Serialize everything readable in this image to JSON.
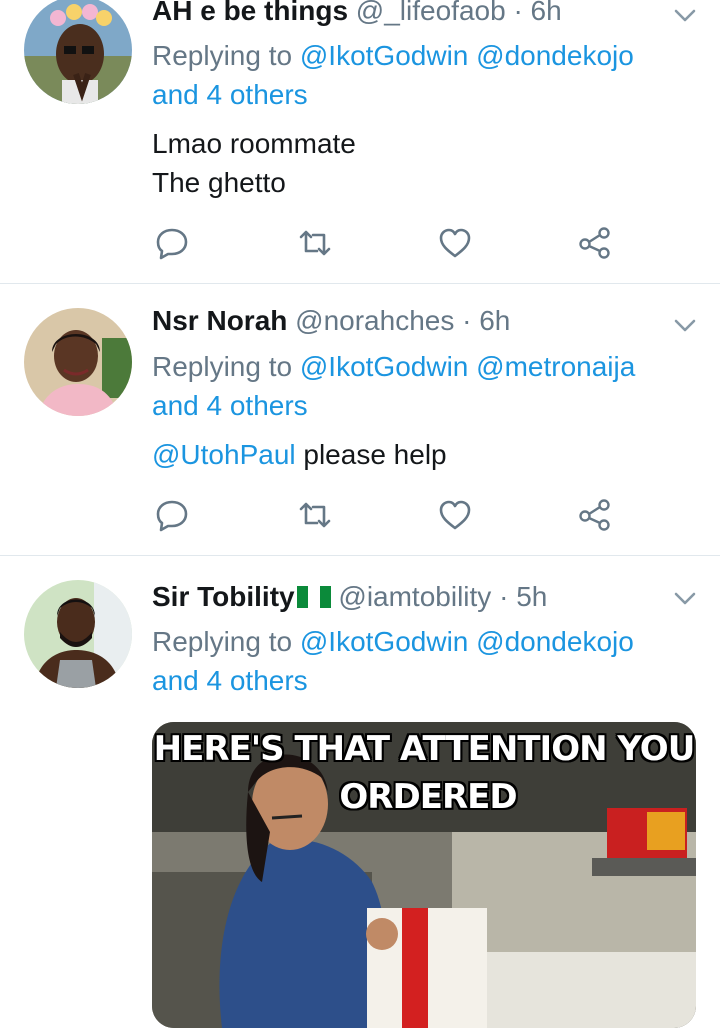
{
  "colors": {
    "link": "#1b95e0",
    "secondary": "#657786",
    "text": "#14171a",
    "divider": "#e1e8ed"
  },
  "tweets": [
    {
      "display_name": "AH e be things",
      "handle": "@_lifeofaob",
      "sep": "·",
      "time": "6h",
      "replying_prefix": "Replying to ",
      "mention_1": "@IkotGodwin",
      "mention_2": "@dondekojo",
      "others": "and 4 others",
      "text_line_1": "Lmao roommate",
      "text_line_2": "The ghetto",
      "avatar_icon": "avatar-photo-flower-crown"
    },
    {
      "display_name": "Nsr Norah",
      "handle": "@norahches",
      "sep": "·",
      "time": "6h",
      "replying_prefix": "Replying to ",
      "mention_1": "@IkotGodwin",
      "mention_2": "@metronaija",
      "others": "and 4 others",
      "text_mention": "@UtohPaul",
      "text_rest": " please help",
      "avatar_icon": "avatar-photo-woman"
    },
    {
      "display_name": "Sir Tobility",
      "flag_icon": "nigeria-flag-icon",
      "handle": "@iamtobility",
      "sep": "·",
      "time": "5h",
      "replying_prefix": "Replying to ",
      "mention_1": "@IkotGodwin",
      "mention_2": "@dondekojo",
      "others": "and 4 others",
      "avatar_icon": "avatar-photo-man",
      "media": {
        "caption_line_1": "HERE'S THAT ATTENTION YOU",
        "caption_line_2": "ORDERED"
      }
    }
  ],
  "action_icons": [
    "reply-icon",
    "retweet-icon",
    "like-icon",
    "share-icon"
  ]
}
